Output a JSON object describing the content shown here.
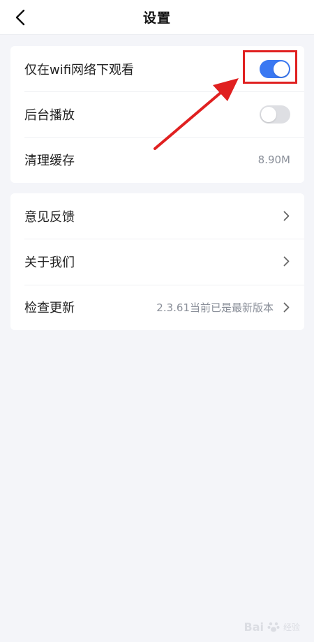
{
  "header": {
    "title": "设置",
    "back_icon": "chevron-left-icon"
  },
  "settings_group_1": [
    {
      "label": "仅在wifi网络下观看",
      "control": "toggle",
      "state": "on"
    },
    {
      "label": "后台播放",
      "control": "toggle",
      "state": "off"
    },
    {
      "label": "清理缓存",
      "value": "8.90M"
    }
  ],
  "settings_group_2": [
    {
      "label": "意见反馈",
      "control": "chevron"
    },
    {
      "label": "关于我们",
      "control": "chevron"
    },
    {
      "label": "检查更新",
      "value": "2.3.61当前已是最新版本",
      "control": "chevron"
    }
  ],
  "colors": {
    "accent": "#3a78f2",
    "toggle_off": "#dedfe3",
    "annotation": "#e02020",
    "background": "#f4f5f9"
  },
  "watermark": {
    "text": "Bai",
    "suffix": "经验"
  }
}
